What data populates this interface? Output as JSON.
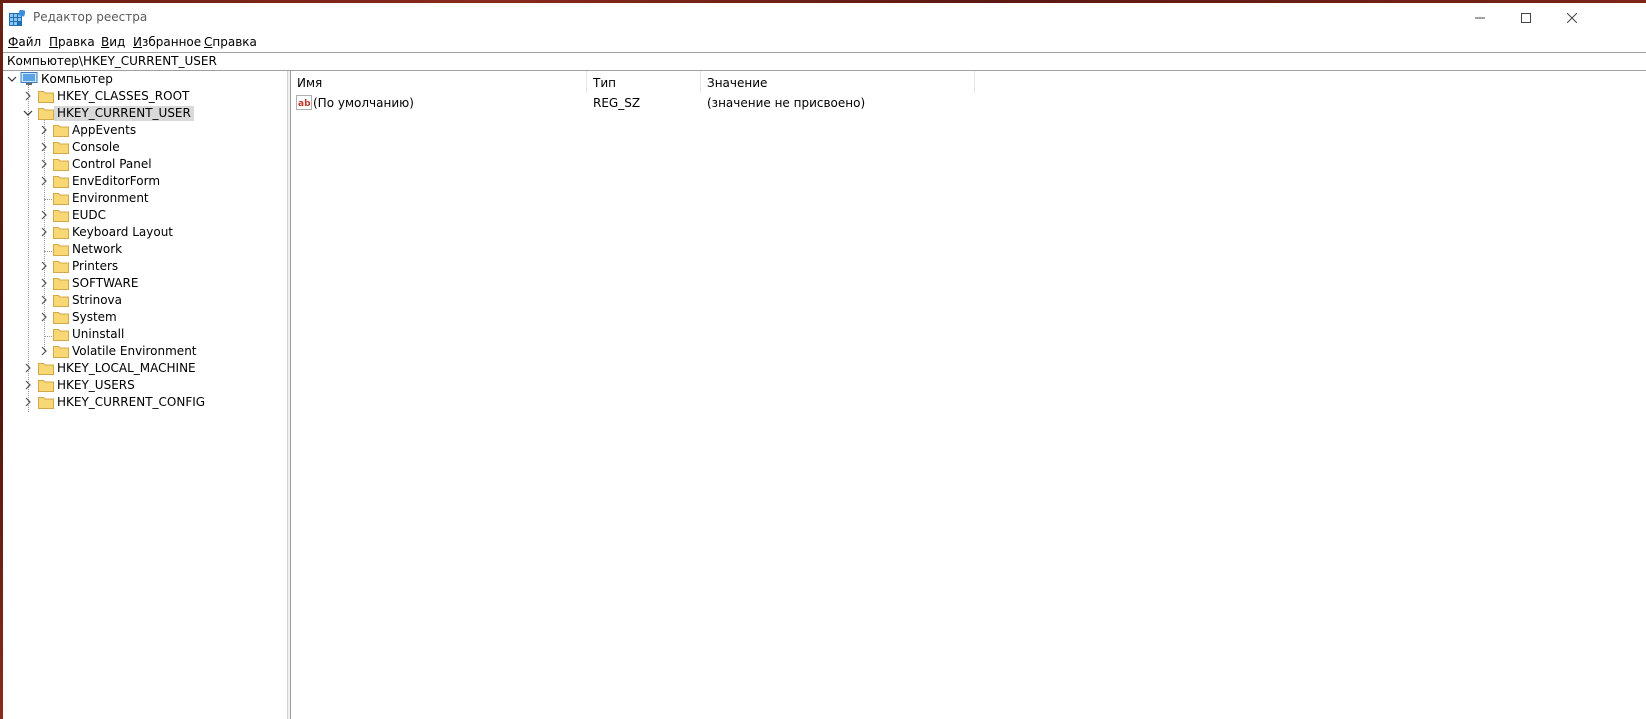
{
  "window": {
    "title": "Редактор реестра"
  },
  "menu": [
    "Файл",
    "Правка",
    "Вид",
    "Избранное",
    "Справка"
  ],
  "address": "Компьютер\\HKEY_CURRENT_USER",
  "tree": {
    "root": "Компьютер",
    "hives": [
      {
        "label": "HKEY_CLASSES_ROOT",
        "expanded": false,
        "has_children": true
      },
      {
        "label": "HKEY_CURRENT_USER",
        "expanded": true,
        "selected": true,
        "has_children": true,
        "children": [
          {
            "label": "AppEvents",
            "has_children": true
          },
          {
            "label": "Console",
            "has_children": true
          },
          {
            "label": "Control Panel",
            "has_children": true
          },
          {
            "label": "EnvEditorForm",
            "has_children": true
          },
          {
            "label": "Environment",
            "has_children": false
          },
          {
            "label": "EUDC",
            "has_children": true
          },
          {
            "label": "Keyboard Layout",
            "has_children": true
          },
          {
            "label": "Network",
            "has_children": false
          },
          {
            "label": "Printers",
            "has_children": true
          },
          {
            "label": "SOFTWARE",
            "has_children": true
          },
          {
            "label": "Strinova",
            "has_children": true
          },
          {
            "label": "System",
            "has_children": true
          },
          {
            "label": "Uninstall",
            "has_children": false
          },
          {
            "label": "Volatile Environment",
            "has_children": true
          }
        ]
      },
      {
        "label": "HKEY_LOCAL_MACHINE",
        "expanded": false,
        "has_children": true
      },
      {
        "label": "HKEY_USERS",
        "expanded": false,
        "has_children": true
      },
      {
        "label": "HKEY_CURRENT_CONFIG",
        "expanded": false,
        "has_children": true
      }
    ]
  },
  "list": {
    "columns": [
      "Имя",
      "Тип",
      "Значение"
    ],
    "rows": [
      {
        "name": "(По умолчанию)",
        "type": "REG_SZ",
        "value": "(значение не присвоено)",
        "icon": "string-value-icon"
      }
    ]
  },
  "colors": {
    "folder": "#f8d775",
    "selection": "#d9d9d9",
    "icon_text": "#c0392b"
  }
}
